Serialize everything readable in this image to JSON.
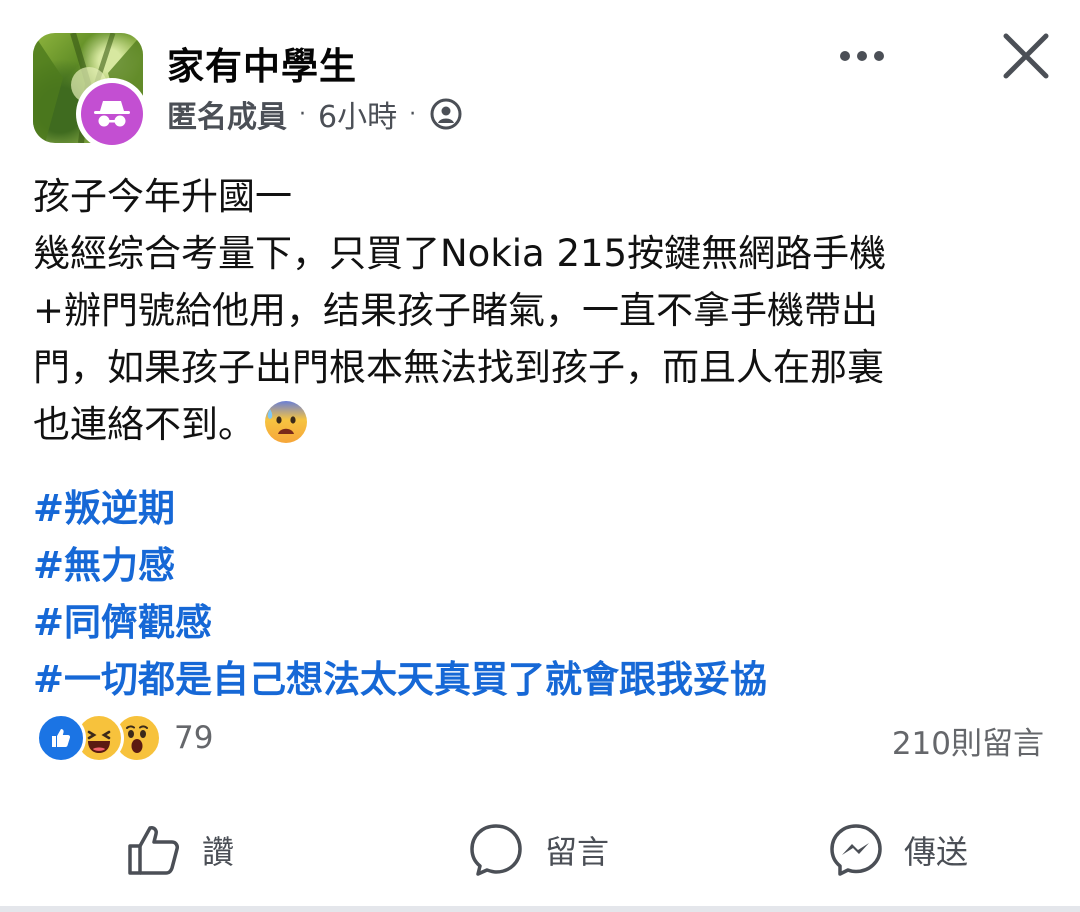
{
  "header": {
    "group_name": "家有中學生",
    "author": "匿名成員",
    "separator": "·",
    "time": "6小時",
    "privacy_icon": "public-globe-icon",
    "more_icon": "more-dots-icon",
    "close_icon": "close-icon"
  },
  "post": {
    "lines": [
      "孩子今年升國一",
      "幾經综合考量下，只買了Nokia 215按鍵無網路手機",
      "+辦門號給他用，结果孩子睹氣，一直不拿手機帶出",
      "門，如果孩子出門根本無法找到孩子，而且人在那裏",
      "也連絡不到。"
    ],
    "emoji": "anxious-sweat-face-emoji",
    "hashtags": [
      "#叛逆期",
      "#無力感",
      "#同儕觀感",
      "#一切都是自己想法太天真買了就會跟我妥協"
    ]
  },
  "stats": {
    "reaction_icons": [
      "like-reaction-icon",
      "haha-reaction-icon",
      "wow-reaction-icon"
    ],
    "reaction_count": "79",
    "comment_count": "210則留言"
  },
  "actions": {
    "like": "讚",
    "comment": "留言",
    "share": "傳送"
  },
  "colors": {
    "hashtag": "#1668d6",
    "anonymous_avatar": "#c34fd2",
    "like_blue": "#1b74e4",
    "secondary_text": "#65676b"
  }
}
